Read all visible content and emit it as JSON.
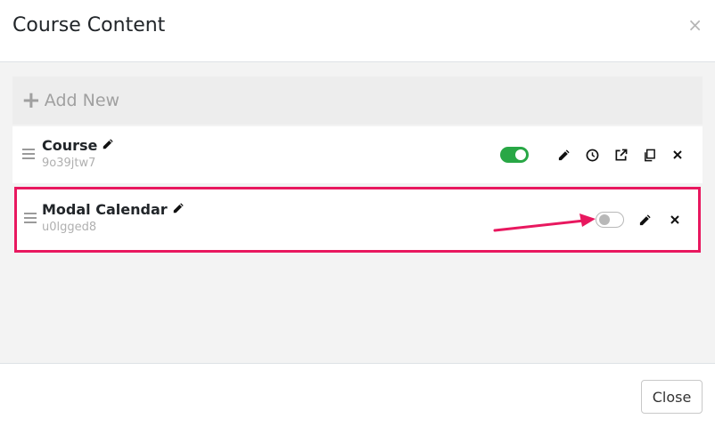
{
  "modal": {
    "title": "Course Content",
    "close_symbol": "×"
  },
  "toolbar": {
    "add_new_label": "Add New",
    "add_new_icon": "plus-icon"
  },
  "items": [
    {
      "name": "Course",
      "code": "9o39jtw7",
      "enabled": true,
      "icons": [
        "drag-handle-icon",
        "pencil-icon",
        "clock-icon",
        "external-link-icon",
        "copy-icon",
        "close-icon"
      ]
    },
    {
      "name": "Modal Calendar",
      "code": "u0lgged8",
      "enabled": false,
      "highlighted": true,
      "icons": [
        "drag-handle-icon",
        "pencil-icon",
        "close-icon"
      ]
    }
  ],
  "footer": {
    "close_label": "Close"
  },
  "colors": {
    "toggle_on": "#28a745",
    "highlight": "#e8185f",
    "body_bg": "#f3f3f3"
  }
}
